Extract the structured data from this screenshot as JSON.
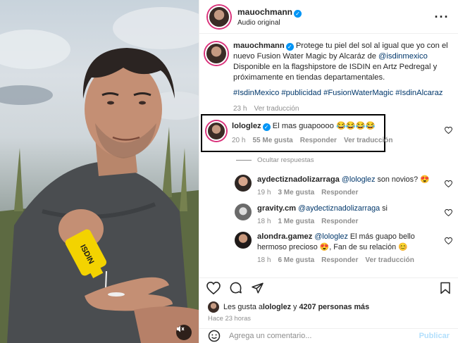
{
  "post": {
    "author": "mauochmann",
    "audio": "Audio original",
    "caption_text_1": "Protege tu piel del sol al igual que yo con el nuevo Fusion Water Magic by Alcaráz de ",
    "caption_mention": "@isdinmexico",
    "caption_text_2": " Disponible en la flagshipstore de ISDIN en Artz Pedregal y próximamente en tiendas departamentales.",
    "hashtags": "#IsdinMexico #publicidad #FusionWaterMagic #IsdinAlcaraz",
    "caption_time": "23 h",
    "see_translation": "Ver traducción",
    "product_label": "ISDIN"
  },
  "comment": {
    "author": "lologlez",
    "text": "El mas guapoooo 😂😂😂😂",
    "time": "20 h",
    "likes": "55 Me gusta",
    "reply": "Responder",
    "translate": "Ver traducción",
    "hide_replies": "Ocultar respuestas"
  },
  "replies": [
    {
      "author": "aydectiznadolizarraga",
      "mention": "@lologlez",
      "text": " son novios? 😍",
      "time": "19 h",
      "likes": "3 Me gusta",
      "reply": "Responder",
      "translate": ""
    },
    {
      "author": "gravity.cm",
      "mention": "@aydectiznadolizarraga",
      "text": " si",
      "time": "18 h",
      "likes": "1 Me gusta",
      "reply": "Responder",
      "translate": ""
    },
    {
      "author": "alondra.gamez",
      "mention": "@lologlez",
      "text": " El más guapo bello hermoso precioso 😍, Fan de su relación 😊",
      "time": "18 h",
      "likes": "6 Me gusta",
      "reply": "Responder",
      "translate": "Ver traducción"
    }
  ],
  "likes_line": {
    "prefix": "Les gusta a ",
    "user": "lologlez",
    "middle": " y ",
    "count": "4207 personas más"
  },
  "posted": "Hace 23 horas",
  "composer": {
    "placeholder": "Agrega un comentario...",
    "publish": "Publicar"
  },
  "colors": {
    "link": "#00376b",
    "verified": "#0095f6",
    "story_ring": "#d9317a",
    "muted_text": "#8e8e8e",
    "publish_disabled": "#b2dffc"
  },
  "icons": [
    "verified-badge-icon",
    "more-options-icon",
    "heart-icon",
    "comment-icon",
    "share-icon",
    "bookmark-icon",
    "emoji-icon",
    "mute-icon"
  ]
}
